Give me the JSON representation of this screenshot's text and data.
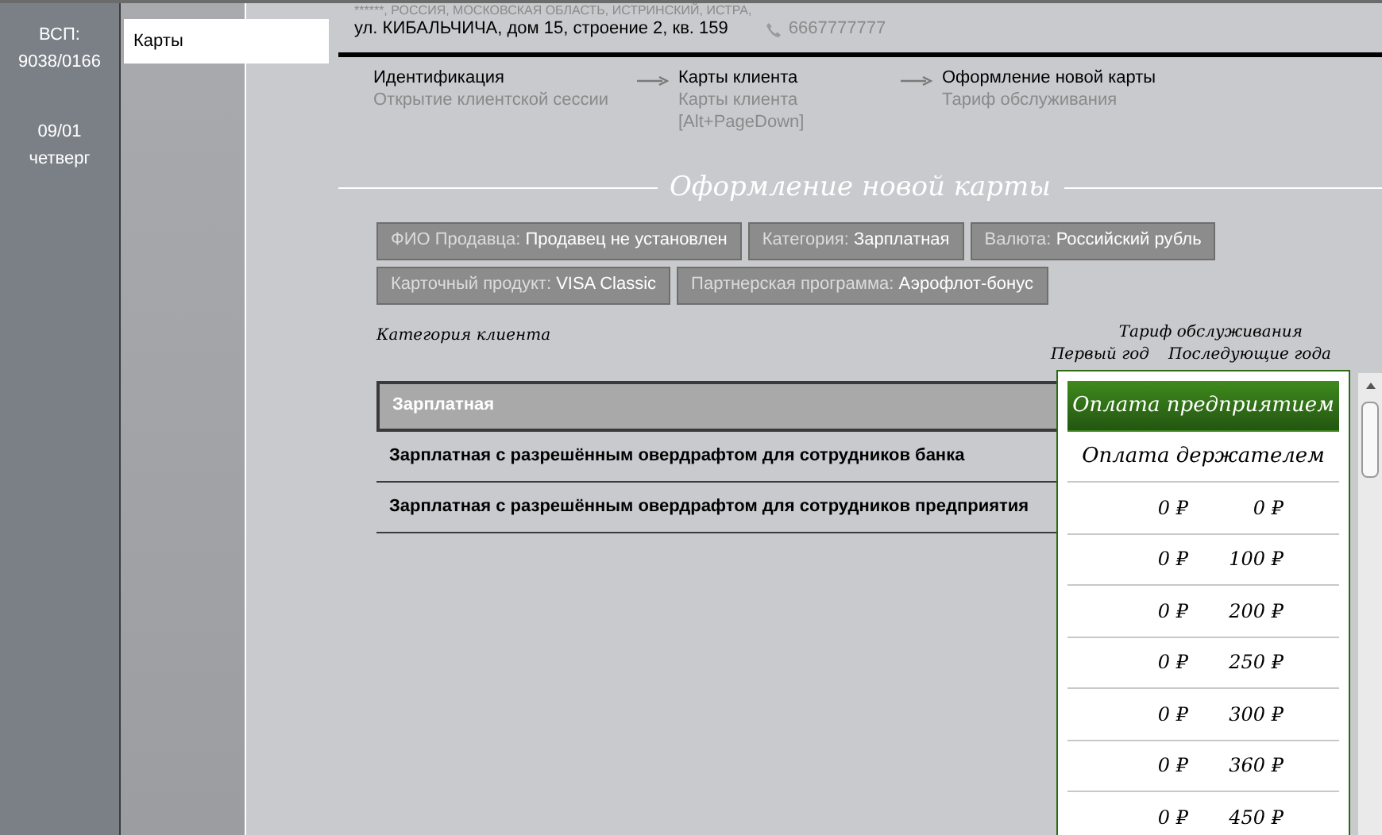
{
  "branch": {
    "label": "ВСП:",
    "code": "9038/0166"
  },
  "date": {
    "day": "09/01",
    "weekday": "четверг"
  },
  "menu": [
    {
      "label": "Карты",
      "selected": true
    }
  ],
  "client": {
    "address_line_1": "******, РОССИЯ, МОСКОВСКАЯ ОБЛАСТЬ, ИСТРИНСКИЙ, ИСТРА,",
    "address_line_2": "ул. КИБАЛЬЧИЧА, дом 15, строение 2, кв. 159",
    "phone": "6667777777"
  },
  "steps": [
    {
      "title": "Идентификация",
      "subtitle": "Открытие клиентской сессии"
    },
    {
      "title": "Карты клиента",
      "subtitle": "Карты клиента",
      "hint": "[Alt+PageDown]"
    },
    {
      "title": "Оформление новой карты",
      "subtitle": "Тариф обслуживания"
    }
  ],
  "section_title": "Оформление новой карты",
  "filters": [
    [
      {
        "label": "ФИО Продавца:",
        "value": "Продавец не установлен"
      },
      {
        "label": "Категория:",
        "value": "Зарплатная"
      },
      {
        "label": "Валюта:",
        "value": "Российский рубль"
      }
    ],
    [
      {
        "label": "Карточный продукт:",
        "value": "VISA Classic"
      },
      {
        "label": "Партнерская программа:",
        "value": "Аэрофлот-бонус"
      }
    ]
  ],
  "table": {
    "category_header": "Категория клиента",
    "tariff_header": "Тариф обслуживания",
    "first_year_header": "Первый год",
    "next_years_header": "Последующие года",
    "categories": [
      {
        "name": "Зарплатная",
        "selected": true
      },
      {
        "name": "Зарплатная с разрешённым овердрафтом для сотрудников банка",
        "selected": false
      },
      {
        "name": "Зарплатная с разрешённым овердрафтом для сотрудников предприятия",
        "selected": false
      }
    ]
  },
  "payment_options": [
    {
      "label": "Оплата предприятием",
      "selected": true
    },
    {
      "label": "Оплата держателем",
      "selected": false
    }
  ],
  "tariffs": [
    {
      "first_year": "0 ₽",
      "next_years": "0 ₽"
    },
    {
      "first_year": "0 ₽",
      "next_years": "100 ₽"
    },
    {
      "first_year": "0 ₽",
      "next_years": "200 ₽"
    },
    {
      "first_year": "0 ₽",
      "next_years": "250 ₽"
    },
    {
      "first_year": "0 ₽",
      "next_years": "300 ₽"
    },
    {
      "first_year": "0 ₽",
      "next_years": "360 ₽"
    },
    {
      "first_year": "0 ₽",
      "next_years": "450 ₽"
    }
  ]
}
